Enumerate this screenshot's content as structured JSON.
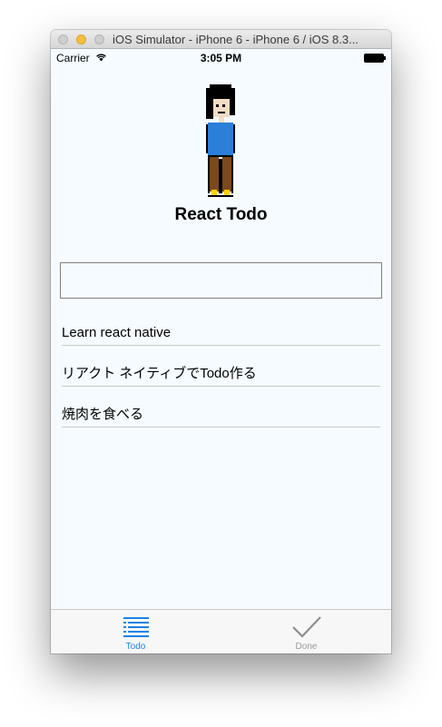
{
  "window": {
    "title": "iOS Simulator - iPhone 6 - iPhone 6 / iOS 8.3..."
  },
  "status_bar": {
    "carrier": "Carrier",
    "time": "3:05 PM",
    "wifi_icon": "wifi-icon",
    "battery_icon": "battery-icon"
  },
  "header": {
    "title": "React Todo",
    "avatar_icon": "pixel-person-avatar"
  },
  "input": {
    "value": "",
    "placeholder": ""
  },
  "todos": [
    {
      "label": "Learn react native"
    },
    {
      "label": "リアクト ネイティブでTodo作る"
    },
    {
      "label": "焼肉を食べる"
    }
  ],
  "tab_bar": {
    "tabs": [
      {
        "label": "Todo",
        "icon": "list-icon",
        "selected": true
      },
      {
        "label": "Done",
        "icon": "checkmark-icon",
        "selected": false
      }
    ]
  },
  "colors": {
    "accent": "#1a82e6",
    "inactive_tab": "#9a9a9a",
    "background": "#f5fbfe"
  }
}
